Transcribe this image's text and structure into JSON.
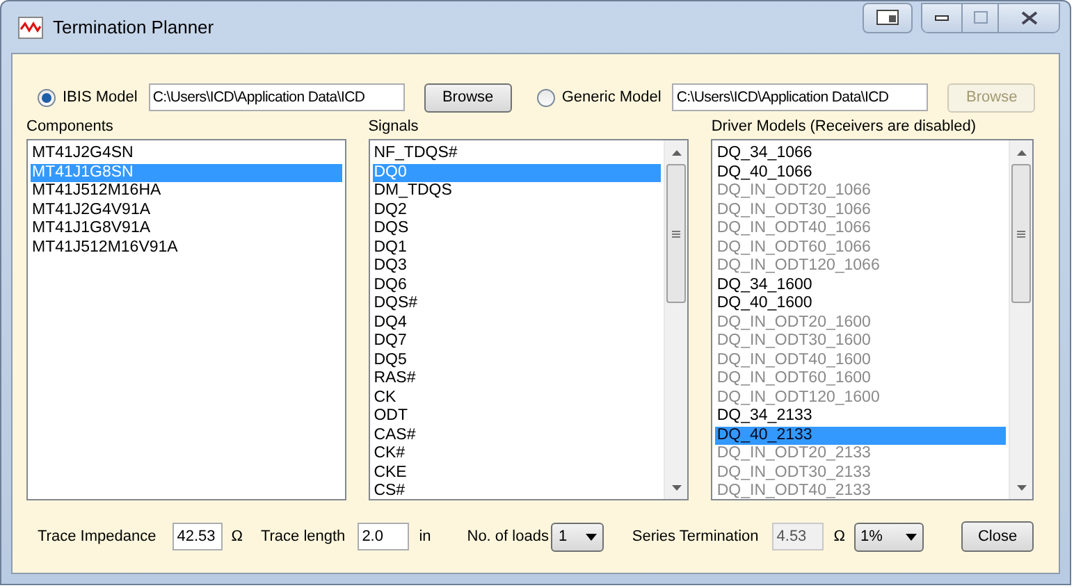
{
  "window": {
    "title": "Termination Planner"
  },
  "models": [
    {
      "label": "IBIS Model",
      "selected": true,
      "path": "C:\\Users\\ICD\\Application Data\\ICD",
      "browse": "Browse",
      "browse_disabled": false
    },
    {
      "label": "Generic Model",
      "selected": false,
      "path": "C:\\Users\\ICD\\Application Data\\ICD",
      "browse": "Browse",
      "browse_disabled": true
    }
  ],
  "components": {
    "label": "Components",
    "items": [
      {
        "name": "MT41J2G4SN",
        "selected": false
      },
      {
        "name": "MT41J1G8SN",
        "selected": true
      },
      {
        "name": "MT41J512M16HA",
        "selected": false
      },
      {
        "name": "MT41J2G4V91A",
        "selected": false
      },
      {
        "name": "MT41J1G8V91A",
        "selected": false
      },
      {
        "name": "MT41J512M16V91A",
        "selected": false
      }
    ]
  },
  "signals": {
    "label": "Signals",
    "items": [
      {
        "name": "NF_TDQS#",
        "selected": false
      },
      {
        "name": "DQ0",
        "selected": true
      },
      {
        "name": "DM_TDQS",
        "selected": false
      },
      {
        "name": "DQ2",
        "selected": false
      },
      {
        "name": "DQS",
        "selected": false
      },
      {
        "name": "DQ1",
        "selected": false
      },
      {
        "name": "DQ3",
        "selected": false
      },
      {
        "name": "DQ6",
        "selected": false
      },
      {
        "name": "DQS#",
        "selected": false
      },
      {
        "name": "DQ4",
        "selected": false
      },
      {
        "name": "DQ7",
        "selected": false
      },
      {
        "name": "DQ5",
        "selected": false
      },
      {
        "name": "RAS#",
        "selected": false
      },
      {
        "name": "CK",
        "selected": false
      },
      {
        "name": "ODT",
        "selected": false
      },
      {
        "name": "CAS#",
        "selected": false
      },
      {
        "name": "CK#",
        "selected": false
      },
      {
        "name": "CKE",
        "selected": false
      },
      {
        "name": "CS#",
        "selected": false
      }
    ]
  },
  "drivers": {
    "label": "Driver Models (Receivers are disabled)",
    "items": [
      {
        "name": "DQ_34_1066",
        "selected": false,
        "disabled": false
      },
      {
        "name": "DQ_40_1066",
        "selected": false,
        "disabled": false
      },
      {
        "name": "DQ_IN_ODT20_1066",
        "selected": false,
        "disabled": true
      },
      {
        "name": "DQ_IN_ODT30_1066",
        "selected": false,
        "disabled": true
      },
      {
        "name": "DQ_IN_ODT40_1066",
        "selected": false,
        "disabled": true
      },
      {
        "name": "DQ_IN_ODT60_1066",
        "selected": false,
        "disabled": true
      },
      {
        "name": "DQ_IN_ODT120_1066",
        "selected": false,
        "disabled": true
      },
      {
        "name": "DQ_34_1600",
        "selected": false,
        "disabled": false
      },
      {
        "name": "DQ_40_1600",
        "selected": false,
        "disabled": false
      },
      {
        "name": "DQ_IN_ODT20_1600",
        "selected": false,
        "disabled": true
      },
      {
        "name": "DQ_IN_ODT30_1600",
        "selected": false,
        "disabled": true
      },
      {
        "name": "DQ_IN_ODT40_1600",
        "selected": false,
        "disabled": true
      },
      {
        "name": "DQ_IN_ODT60_1600",
        "selected": false,
        "disabled": true
      },
      {
        "name": "DQ_IN_ODT120_1600",
        "selected": false,
        "disabled": true
      },
      {
        "name": "DQ_34_2133",
        "selected": false,
        "disabled": false
      },
      {
        "name": "DQ_40_2133",
        "selected": true,
        "disabled": false
      },
      {
        "name": "DQ_IN_ODT20_2133",
        "selected": false,
        "disabled": true
      },
      {
        "name": "DQ_IN_ODT30_2133",
        "selected": false,
        "disabled": true
      },
      {
        "name": "DQ_IN_ODT40_2133",
        "selected": false,
        "disabled": true
      }
    ]
  },
  "bottom": {
    "trace_impedance": {
      "label": "Trace Impedance",
      "value": "42.53",
      "unit": "Ω"
    },
    "trace_length": {
      "label": "Trace length",
      "value": "2.0",
      "unit": "in"
    },
    "loads": {
      "label": "No. of loads",
      "value": "1"
    },
    "series_termination": {
      "label": "Series Termination",
      "value": "4.53",
      "unit": "Ω",
      "tolerance": "1%"
    },
    "close": "Close"
  }
}
